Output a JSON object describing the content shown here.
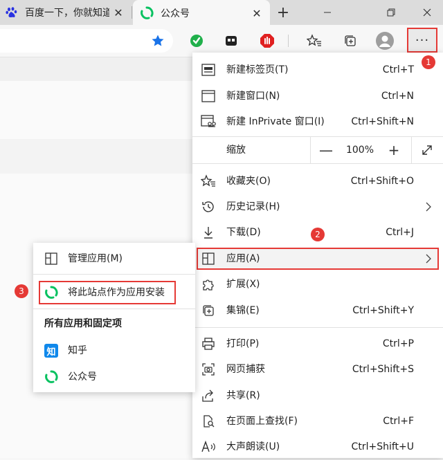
{
  "tabs": [
    {
      "title": "百度一下，你就知道",
      "close": "✕"
    },
    {
      "title": "公众号",
      "close": "✕"
    }
  ],
  "new_tab": "+",
  "toolbar": {
    "more_label": "···"
  },
  "menu": {
    "items": [
      {
        "label": "新建标签页(T)",
        "shortcut": "Ctrl+T"
      },
      {
        "label": "新建窗口(N)",
        "shortcut": "Ctrl+N"
      },
      {
        "label": "新建 InPrivate 窗口(I)",
        "shortcut": "Ctrl+Shift+N"
      },
      {
        "label": "收藏夹(O)",
        "shortcut": "Ctrl+Shift+O"
      },
      {
        "label": "历史记录(H)",
        "shortcut": ""
      },
      {
        "label": "下载(D)",
        "shortcut": "Ctrl+J"
      },
      {
        "label": "应用(A)",
        "shortcut": ""
      },
      {
        "label": "扩展(X)",
        "shortcut": ""
      },
      {
        "label": "集锦(E)",
        "shortcut": "Ctrl+Shift+Y"
      },
      {
        "label": "打印(P)",
        "shortcut": "Ctrl+P"
      },
      {
        "label": "网页捕获",
        "shortcut": "Ctrl+Shift+S"
      },
      {
        "label": "共享(R)",
        "shortcut": ""
      },
      {
        "label": "在页面上查找(F)",
        "shortcut": "Ctrl+F"
      },
      {
        "label": "大声朗读(U)",
        "shortcut": "Ctrl+Shift+U"
      }
    ],
    "zoom": {
      "label": "缩放",
      "minus": "—",
      "value": "100%",
      "plus": "+"
    }
  },
  "submenu": {
    "manage": "管理应用(M)",
    "install": "将此站点作为应用安装",
    "heading": "所有应用和固定项",
    "apps": [
      {
        "icon_text": "知",
        "label": "知乎"
      },
      {
        "label": "公众号"
      }
    ]
  },
  "badges": [
    "1",
    "2",
    "3"
  ],
  "colors": {
    "accent_red": "#e53935",
    "star_blue": "#1a73e8",
    "zhihu_blue": "#0f88eb",
    "wechat_green": "#07c160"
  }
}
